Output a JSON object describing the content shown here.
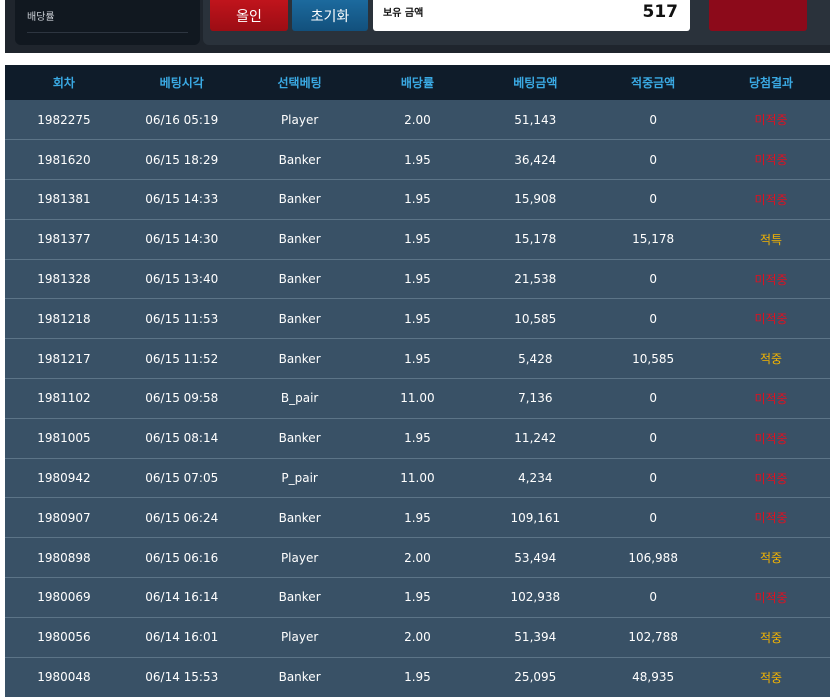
{
  "controls": {
    "odds_label": "배당률",
    "allin_label": "올인",
    "reset_label": "초기화",
    "balance_label": "보유 금액",
    "balance_value": "517"
  },
  "table": {
    "headers": [
      "회차",
      "베팅시각",
      "선택베팅",
      "배당률",
      "베팅금액",
      "적중금액",
      "당첨결과"
    ],
    "rows": [
      [
        "1982275",
        "06/16 05:19",
        "Player",
        "2.00",
        "51,143",
        "0",
        "미적중"
      ],
      [
        "1981620",
        "06/15 18:29",
        "Banker",
        "1.95",
        "36,424",
        "0",
        "미적중"
      ],
      [
        "1981381",
        "06/15 14:33",
        "Banker",
        "1.95",
        "15,908",
        "0",
        "미적중"
      ],
      [
        "1981377",
        "06/15 14:30",
        "Banker",
        "1.95",
        "15,178",
        "15,178",
        "적특"
      ],
      [
        "1981328",
        "06/15 13:40",
        "Banker",
        "1.95",
        "21,538",
        "0",
        "미적중"
      ],
      [
        "1981218",
        "06/15 11:53",
        "Banker",
        "1.95",
        "10,585",
        "0",
        "미적중"
      ],
      [
        "1981217",
        "06/15 11:52",
        "Banker",
        "1.95",
        "5,428",
        "10,585",
        "적중"
      ],
      [
        "1981102",
        "06/15 09:58",
        "B_pair",
        "11.00",
        "7,136",
        "0",
        "미적중"
      ],
      [
        "1981005",
        "06/15 08:14",
        "Banker",
        "1.95",
        "11,242",
        "0",
        "미적중"
      ],
      [
        "1980942",
        "06/15 07:05",
        "P_pair",
        "11.00",
        "4,234",
        "0",
        "미적중"
      ],
      [
        "1980907",
        "06/15 06:24",
        "Banker",
        "1.95",
        "109,161",
        "0",
        "미적중"
      ],
      [
        "1980898",
        "06/15 06:16",
        "Player",
        "2.00",
        "53,494",
        "106,988",
        "적중"
      ],
      [
        "1980069",
        "06/14 16:14",
        "Banker",
        "1.95",
        "102,938",
        "0",
        "미적중"
      ],
      [
        "1980056",
        "06/14 16:01",
        "Player",
        "2.00",
        "51,394",
        "102,788",
        "적중"
      ],
      [
        "1980048",
        "06/14 15:53",
        "Banker",
        "1.95",
        "25,095",
        "48,935",
        "적중"
      ]
    ]
  },
  "colors": {
    "result_lose": "#e01020",
    "result_win": "#f4b400",
    "header_text": "#3aa9e3"
  }
}
